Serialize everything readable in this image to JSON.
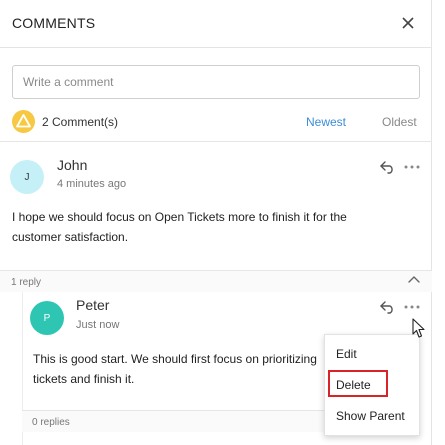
{
  "header": {
    "title": "COMMENTS"
  },
  "input": {
    "placeholder": "Write a comment"
  },
  "summary": {
    "count_text": "2 Comment(s)",
    "sort_newest": "Newest",
    "sort_oldest": "Oldest"
  },
  "comments": [
    {
      "avatar_initial": "J",
      "author": "John",
      "time": "4 minutes ago",
      "text": "I hope we should focus on Open Tickets more to finish it for the customer satisfaction.",
      "reply_count": "1 reply",
      "replies": [
        {
          "avatar_initial": "P",
          "author": "Peter",
          "time": "Just now",
          "text": "This is good start. We should first focus on prioritizing tickets and finish it.",
          "reply_count": "0 replies"
        }
      ]
    }
  ],
  "context_menu": {
    "items": [
      "Edit",
      "Delete",
      "Show Parent"
    ],
    "highlighted": "Delete",
    "highlight_color": "#d8232a"
  },
  "colors": {
    "accent": "#3c8dd9",
    "alert": "#f7c842",
    "avatar_john": "#c6f0f8",
    "avatar_peter": "#2ec6b3"
  },
  "icons": {
    "close": "close-icon",
    "alert": "warning-icon",
    "reply": "reply-icon",
    "more": "more-horizontal-icon",
    "collapse": "chevron-up-icon",
    "cursor": "mouse-cursor-icon"
  }
}
